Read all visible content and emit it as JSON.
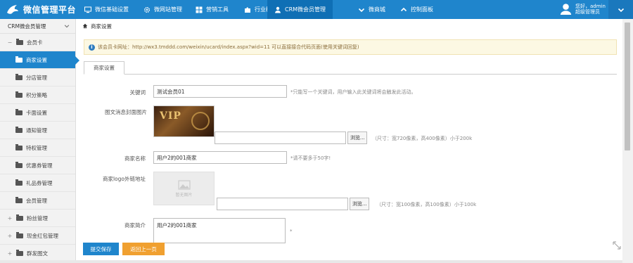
{
  "app": {
    "title": "微信管理平台"
  },
  "topnav": [
    {
      "label": "微信基础设置",
      "icon": "monitor-icon"
    },
    {
      "label": "微网站管理",
      "icon": "gear-icon"
    },
    {
      "label": "营销工具",
      "icon": "grid-icon"
    },
    {
      "label": "行业模块",
      "icon": "puzzle-icon"
    },
    {
      "label": "CRM微会员管理",
      "icon": "user-icon",
      "active": true
    },
    {
      "label": "微商城",
      "icon": "chevron-down-icon"
    },
    {
      "label": "控制面板",
      "icon": "chevron-up-icon"
    }
  ],
  "user": {
    "greeting": "您好，admin",
    "role": "超级管理员"
  },
  "sidebar": {
    "header": "CRM微会员管理",
    "items": [
      {
        "label": "会员卡",
        "level": 1,
        "toggle": "−"
      },
      {
        "label": "商家设置",
        "level": 2,
        "active": true
      },
      {
        "label": "分店管理",
        "level": 2
      },
      {
        "label": "积分策略",
        "level": 2
      },
      {
        "label": "卡面设置",
        "level": 2
      },
      {
        "label": "通知管理",
        "level": 2
      },
      {
        "label": "特权管理",
        "level": 2
      },
      {
        "label": "优惠券管理",
        "level": 2
      },
      {
        "label": "礼品券管理",
        "level": 2
      },
      {
        "label": "会员管理",
        "level": 2
      },
      {
        "label": "粉丝管理",
        "level": 1,
        "toggle": "+"
      },
      {
        "label": "现金红包管理",
        "level": 1,
        "toggle": "+"
      },
      {
        "label": "群发图文",
        "level": 1,
        "toggle": "+"
      }
    ]
  },
  "breadcrumb": {
    "label": "商家设置"
  },
  "notice": {
    "text": "该会员卡网址：http://wx3.tmddd.com/weixin/ucard/index.aspx?wid=11 可以直接接合代码页面(使用关键词回复)"
  },
  "tabs": [
    {
      "label": "商家设置"
    }
  ],
  "form": {
    "keyword": {
      "label": "关键词",
      "value": "测试会员01",
      "hint": "*只能写一个关键词，用户输入此关键词将会触发此活动。"
    },
    "cover": {
      "label": "图文消息封面图片",
      "browse": "浏览...",
      "hint": "（尺寸：宽720像素，高400像素）小于200k",
      "image_text": "VIP"
    },
    "name": {
      "label": "商家名称",
      "value": "用户2的001商家",
      "hint": "*请不要多于50字!"
    },
    "logo": {
      "label": "商家logo外链地址",
      "browse": "浏览...",
      "hint": "（尺寸：宽100像素，高100像素）小于100k",
      "placeholder_text": "暂无图片"
    },
    "intro": {
      "label": "商家简介",
      "value": "用户2的001商家",
      "hint": "*"
    }
  },
  "footer": {
    "save": "提交保存",
    "back": "返回上一页"
  },
  "colors": {
    "brand": "#1f85cc",
    "save": "#1f85cc",
    "back": "#f0a030"
  }
}
